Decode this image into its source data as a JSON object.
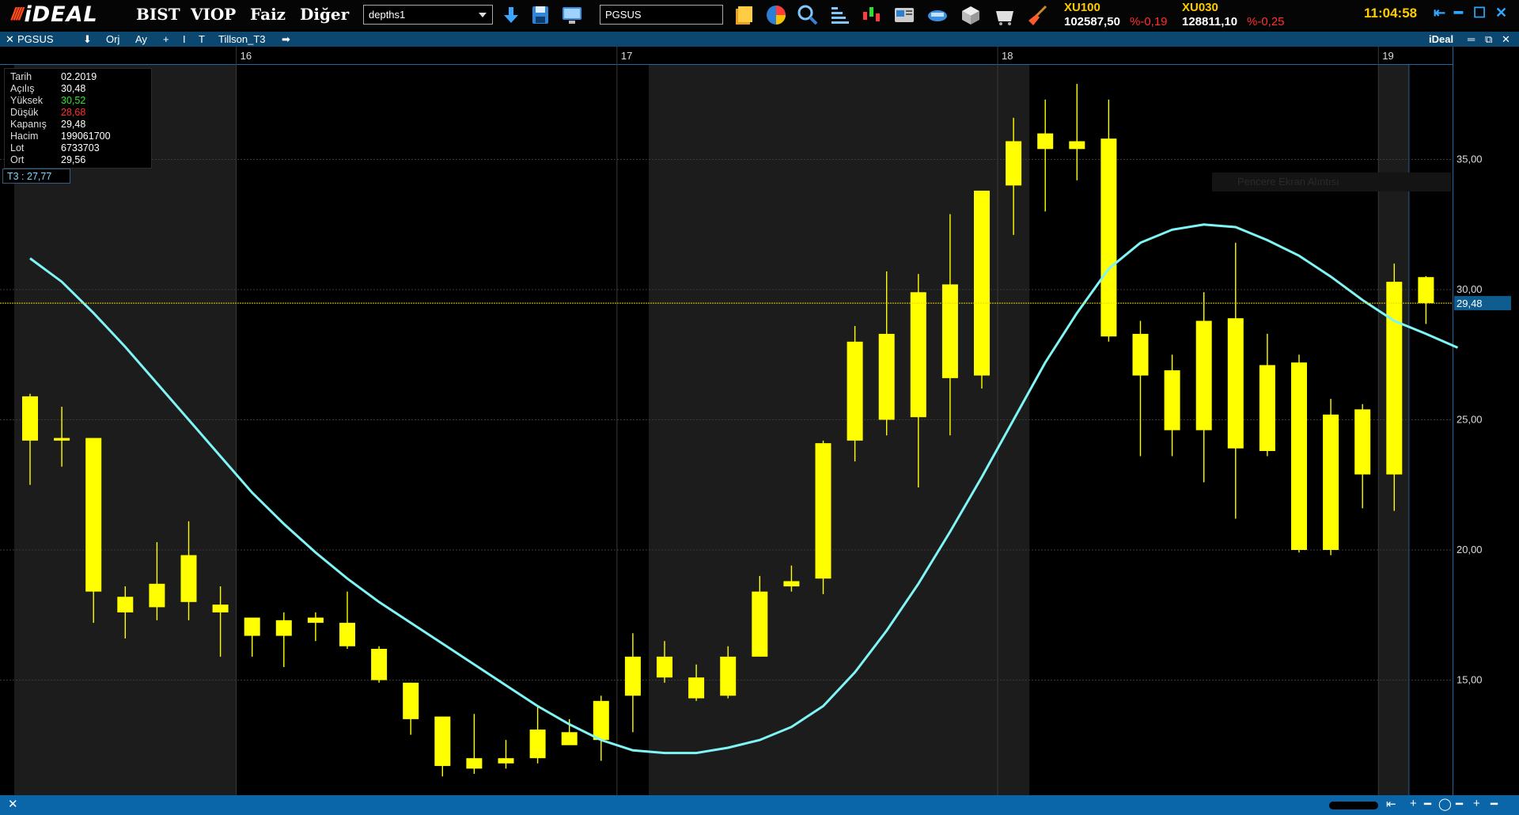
{
  "toolbar": {
    "logo_marks": "////",
    "logo_text": "iDEAL",
    "menu": [
      "BIST",
      "VIOP",
      "Faiz",
      "Diğer"
    ],
    "layout_select": "depths1",
    "symbol_input": "PGSUS",
    "icons": [
      "download-arrow-icon",
      "save-disk-icon",
      "monitor-icon",
      "portfolio-icon",
      "pie-chart-icon",
      "magnifier-icon",
      "depth-bars-icon",
      "candles-icon",
      "news-icon",
      "bank-card-icon",
      "cube-icon",
      "basket-icon",
      "broom-icon"
    ],
    "indices": [
      {
        "name": "XU100",
        "value": "102587,50",
        "change": "%-0,19"
      },
      {
        "name": "XU030",
        "value": "128811,10",
        "change": "%-0,25"
      }
    ],
    "clock": "11:04:58",
    "window_controls": [
      "⇤",
      "━",
      "☐",
      "✕"
    ]
  },
  "chart_header": {
    "items": [
      "✕",
      "PGSUS",
      "⬇",
      "Orj",
      "Ay",
      "+",
      "I",
      "T",
      "Tillson_T3",
      "➡"
    ],
    "brand": "iDeal",
    "controls": [
      "═",
      "⧉",
      "✕"
    ]
  },
  "info_panel": {
    "rows": [
      {
        "key": "Tarih",
        "value": "02.2019",
        "color": "#ffffff"
      },
      {
        "key": "Açılış",
        "value": "30,48",
        "color": "#ffffff"
      },
      {
        "key": "Yüksek",
        "value": "30,52",
        "color": "#2eea2e"
      },
      {
        "key": "Düşük",
        "value": "28,68",
        "color": "#ff3030"
      },
      {
        "key": "Kapanış",
        "value": "29,48",
        "color": "#ffffff"
      },
      {
        "key": "Hacim",
        "value": "199061700",
        "color": "#ffffff"
      },
      {
        "key": "Lot",
        "value": "6733703",
        "color": "#ffffff"
      },
      {
        "key": "Ort",
        "value": "29,56",
        "color": "#ffffff"
      }
    ],
    "t3_label": "T3 : 27,77"
  },
  "ghost_tooltip": "Pencere Ekran Alıntısı",
  "status_bar": {
    "left": "✕",
    "right": [
      "⇤",
      "+",
      "━",
      "◯",
      "━",
      "+",
      "━"
    ]
  },
  "colors": {
    "candle": "#ffff00",
    "t3_line": "#7ff5f5",
    "last_price_line": "#e6d800",
    "grid": "#3a3a3a",
    "shade": "#1c1c1c",
    "price_tag_bg": "#0f5d8f"
  },
  "chart_data": {
    "type": "candlestick",
    "symbol": "PGSUS",
    "period": "Ay",
    "x_ticks": [
      "16",
      "17",
      "18",
      "19"
    ],
    "x_tick_candle_index": [
      7,
      19,
      31,
      43
    ],
    "y_ticks": [
      "15,00",
      "20,00",
      "25,00",
      "30,00",
      "35,00"
    ],
    "y_tick_values": [
      15,
      20,
      25,
      30,
      35
    ],
    "ylim": [
      10.7,
      38.9
    ],
    "last_price": 29.48,
    "last_price_label": "29,48",
    "shaded_year_bands": [
      [
        -0.5,
        6.5
      ],
      [
        19.5,
        31.5
      ],
      [
        42.5,
        43.5
      ]
    ],
    "candles": [
      {
        "o": 24.2,
        "h": 26.0,
        "l": 22.5,
        "c": 25.9
      },
      {
        "o": 24.3,
        "h": 25.5,
        "l": 23.2,
        "c": 24.2
      },
      {
        "o": 24.3,
        "h": 24.3,
        "l": 17.2,
        "c": 18.4
      },
      {
        "o": 17.6,
        "h": 18.6,
        "l": 16.6,
        "c": 18.2
      },
      {
        "o": 17.8,
        "h": 20.3,
        "l": 17.3,
        "c": 18.7
      },
      {
        "o": 18.0,
        "h": 21.1,
        "l": 17.3,
        "c": 19.8
      },
      {
        "o": 17.6,
        "h": 18.6,
        "l": 15.9,
        "c": 17.9
      },
      {
        "o": 16.7,
        "h": 17.4,
        "l": 15.9,
        "c": 17.4
      },
      {
        "o": 16.7,
        "h": 17.6,
        "l": 15.5,
        "c": 17.3
      },
      {
        "o": 17.2,
        "h": 17.6,
        "l": 16.5,
        "c": 17.4
      },
      {
        "o": 17.2,
        "h": 18.4,
        "l": 16.2,
        "c": 16.3
      },
      {
        "o": 16.2,
        "h": 16.3,
        "l": 14.9,
        "c": 15.0
      },
      {
        "o": 14.9,
        "h": 14.9,
        "l": 12.9,
        "c": 13.5
      },
      {
        "o": 13.6,
        "h": 13.6,
        "l": 11.3,
        "c": 11.7
      },
      {
        "o": 11.6,
        "h": 13.7,
        "l": 11.4,
        "c": 12.0
      },
      {
        "o": 11.8,
        "h": 12.7,
        "l": 11.6,
        "c": 12.0
      },
      {
        "o": 12.0,
        "h": 14.0,
        "l": 11.8,
        "c": 13.1
      },
      {
        "o": 13.0,
        "h": 13.5,
        "l": 12.6,
        "c": 12.5
      },
      {
        "o": 12.7,
        "h": 14.4,
        "l": 11.9,
        "c": 14.2
      },
      {
        "o": 14.4,
        "h": 16.8,
        "l": 13.0,
        "c": 15.9
      },
      {
        "o": 15.1,
        "h": 16.5,
        "l": 14.9,
        "c": 15.9
      },
      {
        "o": 15.1,
        "h": 15.6,
        "l": 14.2,
        "c": 14.3
      },
      {
        "o": 14.4,
        "h": 16.3,
        "l": 14.3,
        "c": 15.9
      },
      {
        "o": 15.9,
        "h": 19.0,
        "l": 15.9,
        "c": 18.4
      },
      {
        "o": 18.6,
        "h": 19.4,
        "l": 18.4,
        "c": 18.8
      },
      {
        "o": 18.9,
        "h": 24.2,
        "l": 18.3,
        "c": 24.1
      },
      {
        "o": 24.2,
        "h": 28.6,
        "l": 23.4,
        "c": 28.0
      },
      {
        "o": 25.0,
        "h": 30.7,
        "l": 24.4,
        "c": 28.3
      },
      {
        "o": 25.1,
        "h": 30.6,
        "l": 22.4,
        "c": 29.9
      },
      {
        "o": 26.6,
        "h": 32.9,
        "l": 24.4,
        "c": 30.2
      },
      {
        "o": 26.7,
        "h": 33.8,
        "l": 26.2,
        "c": 33.8
      },
      {
        "o": 34.0,
        "h": 36.6,
        "l": 32.1,
        "c": 35.7
      },
      {
        "o": 35.4,
        "h": 37.3,
        "l": 33.0,
        "c": 36.0
      },
      {
        "o": 35.4,
        "h": 37.9,
        "l": 34.2,
        "c": 35.7
      },
      {
        "o": 35.8,
        "h": 37.3,
        "l": 28.0,
        "c": 28.2
      },
      {
        "o": 28.3,
        "h": 28.8,
        "l": 23.6,
        "c": 26.7
      },
      {
        "o": 24.6,
        "h": 27.5,
        "l": 23.6,
        "c": 26.9
      },
      {
        "o": 24.6,
        "h": 29.9,
        "l": 22.6,
        "c": 28.8
      },
      {
        "o": 23.9,
        "h": 31.8,
        "l": 21.2,
        "c": 28.9
      },
      {
        "o": 23.8,
        "h": 28.3,
        "l": 23.6,
        "c": 27.1
      },
      {
        "o": 20.0,
        "h": 27.5,
        "l": 19.9,
        "c": 27.2
      },
      {
        "o": 20.0,
        "h": 25.8,
        "l": 19.8,
        "c": 25.2
      },
      {
        "o": 22.9,
        "h": 25.6,
        "l": 21.6,
        "c": 25.4
      },
      {
        "o": 22.9,
        "h": 31.0,
        "l": 21.5,
        "c": 30.3
      },
      {
        "o": 30.48,
        "h": 30.52,
        "l": 28.68,
        "c": 29.48
      }
    ],
    "series": [
      {
        "name": "Tillson_T3",
        "values": [
          31.2,
          30.3,
          29.1,
          27.8,
          26.4,
          25.0,
          23.6,
          22.2,
          21.0,
          19.9,
          18.9,
          18.0,
          17.2,
          16.4,
          15.6,
          14.8,
          14.0,
          13.3,
          12.7,
          12.3,
          12.2,
          12.2,
          12.4,
          12.7,
          13.2,
          14.0,
          15.3,
          16.9,
          18.7,
          20.7,
          22.8,
          25.0,
          27.2,
          29.1,
          30.8,
          31.8,
          32.3,
          32.5,
          32.4,
          31.9,
          31.3,
          30.5,
          29.6,
          28.8,
          28.3,
          27.77
        ]
      }
    ]
  }
}
